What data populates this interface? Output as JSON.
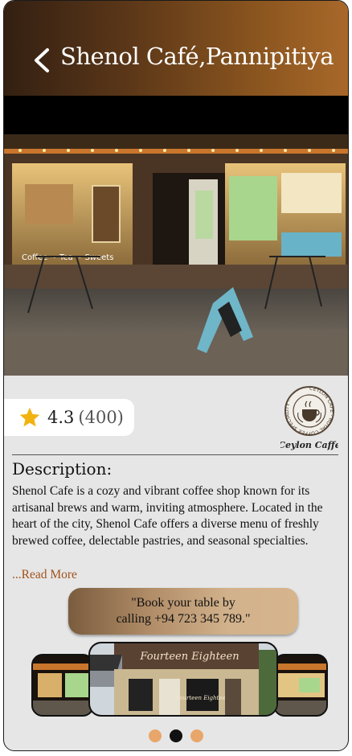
{
  "header": {
    "title": "Shenol Café,Pannipitiya",
    "back_icon": "chevron-left-icon",
    "gradient_colors": [
      "#332012",
      "#a8682a"
    ]
  },
  "rating": {
    "value": "4.3",
    "count": "(400)",
    "icon": "star-icon",
    "star_color": "#f2b311"
  },
  "logo": {
    "name": "Ceylon Caffe logo",
    "ring_text": "CEYLON CAFE · ROYAL COFFEE SPECIALITY ·",
    "script_text": "Ceylon Caffe"
  },
  "hero": {
    "signage_text": "Coffee ~ Tea ~ Sweets"
  },
  "description": {
    "heading": "Description:",
    "body": "Shenol Cafe is a cozy and vibrant coffee shop known for its artisanal brews and warm, inviting atmosphere. Located in the heart of the city, Shenol Cafe offers a diverse menu of freshly brewed coffee, delectable pastries, and seasonal specialties.",
    "read_more": "...Read More",
    "link_color": "#a0521b"
  },
  "cta": {
    "line1": "\"Book your table by",
    "line2": "calling +94 723 345 789.\""
  },
  "carousel": {
    "center_sign": "Fourteen Eighteen",
    "center_window": "Fourteen Eighteen",
    "active_index": 1,
    "dots": [
      "dot-1",
      "dot-2",
      "dot-3"
    ],
    "dot_color": "#e8a66a",
    "dot_active_color": "#111111"
  }
}
